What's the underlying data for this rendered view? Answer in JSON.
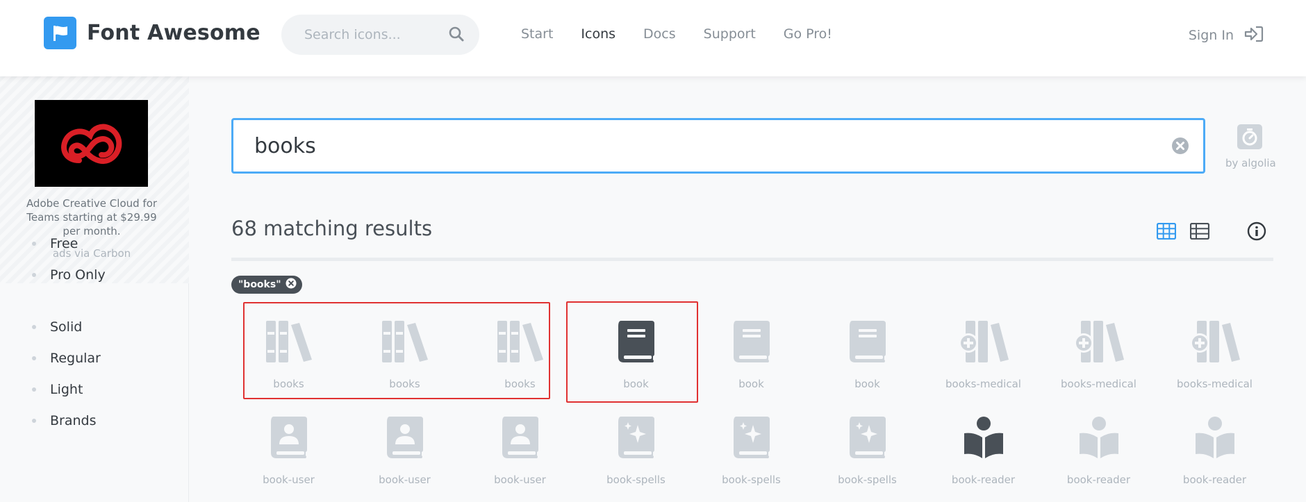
{
  "header": {
    "brand": "Font Awesome",
    "search_placeholder": "Search icons...",
    "nav": [
      "Start",
      "Icons",
      "Docs",
      "Support",
      "Go Pro!"
    ],
    "nav_active": "Icons",
    "signin_label": "Sign In"
  },
  "sidebar": {
    "ad_text": "Adobe Creative Cloud for Teams starting at $29.99 per month.",
    "ad_via": "ads via Carbon",
    "filters_group1": [
      "Free",
      "Pro Only"
    ],
    "filters_group2": [
      "Solid",
      "Regular",
      "Light",
      "Brands"
    ]
  },
  "main": {
    "search_value": "books",
    "algolia_label": "by algolia",
    "results_title": "68 matching results",
    "tag": "\"books\"",
    "icons": [
      {
        "label": "books",
        "icon": "books-icon",
        "style": "light"
      },
      {
        "label": "books",
        "icon": "books-icon",
        "style": "light"
      },
      {
        "label": "books",
        "icon": "books-icon",
        "style": "light"
      },
      {
        "label": "book",
        "icon": "book-icon",
        "style": "dark"
      },
      {
        "label": "book",
        "icon": "book-icon",
        "style": "light"
      },
      {
        "label": "book",
        "icon": "book-icon",
        "style": "light"
      },
      {
        "label": "books-medical",
        "icon": "books-medical-icon",
        "style": "light"
      },
      {
        "label": "books-medical",
        "icon": "books-medical-icon",
        "style": "light"
      },
      {
        "label": "books-medical",
        "icon": "books-medical-icon",
        "style": "light"
      },
      {
        "label": "book-user",
        "icon": "book-user-icon",
        "style": "light"
      },
      {
        "label": "book-user",
        "icon": "book-user-icon",
        "style": "light"
      },
      {
        "label": "book-user",
        "icon": "book-user-icon",
        "style": "light"
      },
      {
        "label": "book-spells",
        "icon": "book-spells-icon",
        "style": "light"
      },
      {
        "label": "book-spells",
        "icon": "book-spells-icon",
        "style": "light"
      },
      {
        "label": "book-spells",
        "icon": "book-spells-icon",
        "style": "light"
      },
      {
        "label": "book-reader",
        "icon": "book-reader-icon",
        "style": "dark"
      },
      {
        "label": "book-reader",
        "icon": "book-reader-icon",
        "style": "light"
      },
      {
        "label": "book-reader",
        "icon": "book-reader-icon",
        "style": "light"
      }
    ]
  },
  "colors": {
    "accent": "#339af0",
    "highlight": "#e03131",
    "icon_light": "#ced4da",
    "icon_dark": "#495057"
  }
}
